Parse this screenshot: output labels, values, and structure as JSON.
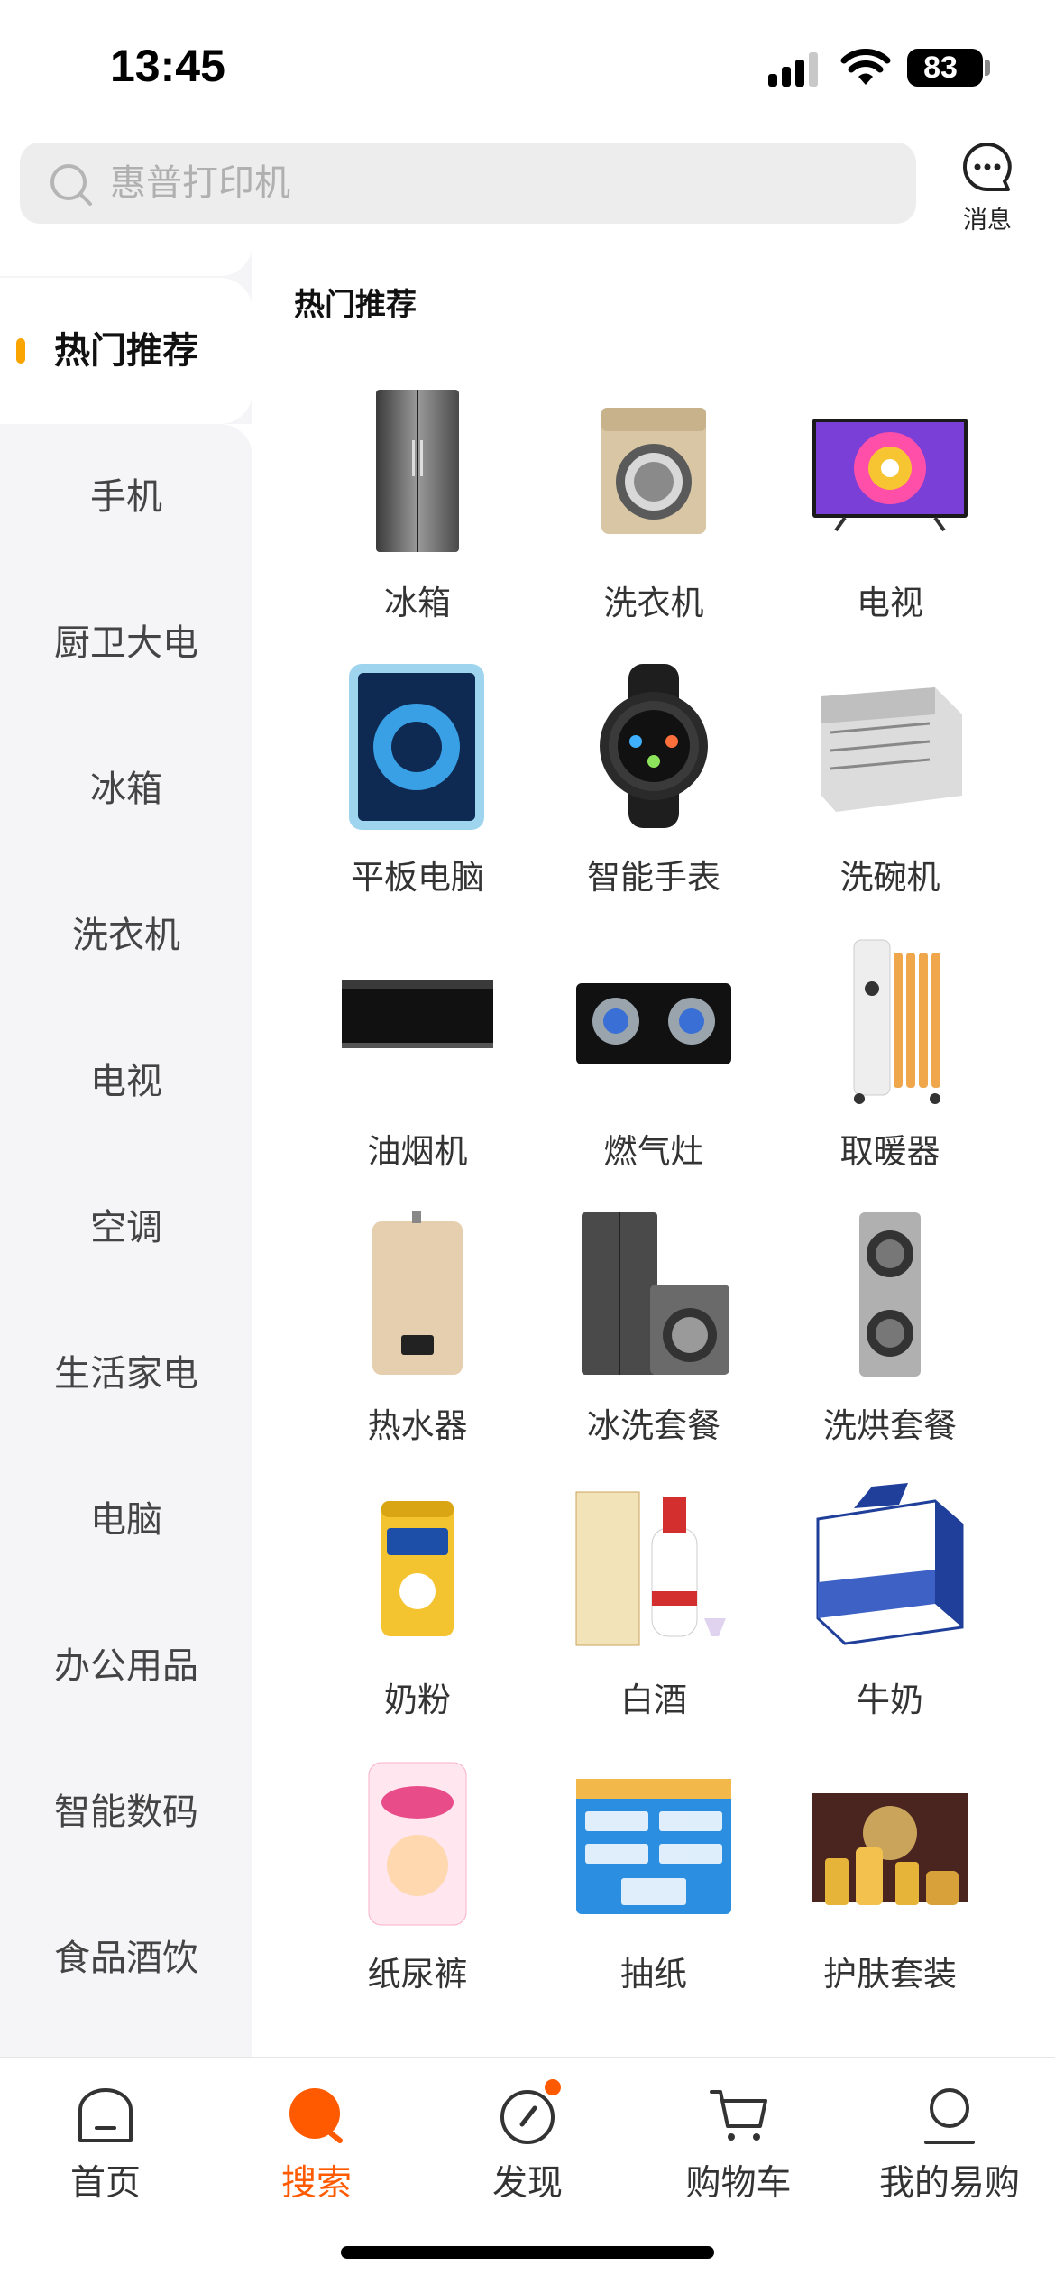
{
  "status_bar": {
    "time": "13:45",
    "battery": "83",
    "icons": [
      "signal-icon",
      "wifi-icon",
      "battery-icon"
    ]
  },
  "header": {
    "search_placeholder": "惠普打印机",
    "message_label": "消息"
  },
  "colors": {
    "accent": "#ff5a00",
    "active_marker": "#f9a400",
    "sidebar_bg": "#f5f5f7"
  },
  "sidebar": {
    "items": [
      {
        "label": "热门推荐",
        "active": true
      },
      {
        "label": "手机"
      },
      {
        "label": "厨卫大电"
      },
      {
        "label": "冰箱"
      },
      {
        "label": "洗衣机"
      },
      {
        "label": "电视"
      },
      {
        "label": "空调"
      },
      {
        "label": "生活家电"
      },
      {
        "label": "电脑"
      },
      {
        "label": "办公用品"
      },
      {
        "label": "智能数码"
      },
      {
        "label": "食品酒饮"
      }
    ]
  },
  "content": {
    "section_title": "热门推荐",
    "items": [
      {
        "label": "冰箱",
        "icon": "refrigerator-icon"
      },
      {
        "label": "洗衣机",
        "icon": "washing-machine-icon"
      },
      {
        "label": "电视",
        "icon": "tv-icon"
      },
      {
        "label": "平板电脑",
        "icon": "tablet-icon"
      },
      {
        "label": "智能手表",
        "icon": "smartwatch-icon"
      },
      {
        "label": "洗碗机",
        "icon": "dishwasher-icon"
      },
      {
        "label": "油烟机",
        "icon": "range-hood-icon"
      },
      {
        "label": "燃气灶",
        "icon": "gas-stove-icon"
      },
      {
        "label": "取暖器",
        "icon": "heater-icon"
      },
      {
        "label": "热水器",
        "icon": "water-heater-icon"
      },
      {
        "label": "冰洗套餐",
        "icon": "fridge-washer-bundle-icon"
      },
      {
        "label": "洗烘套餐",
        "icon": "washer-dryer-stack-icon"
      },
      {
        "label": "奶粉",
        "icon": "milk-powder-can-icon"
      },
      {
        "label": "白酒",
        "icon": "baijiu-bottle-icon"
      },
      {
        "label": "牛奶",
        "icon": "milk-box-icon"
      },
      {
        "label": "纸尿裤",
        "icon": "diaper-pack-icon"
      },
      {
        "label": "抽纸",
        "icon": "tissue-pack-icon"
      },
      {
        "label": "护肤套装",
        "icon": "skincare-set-icon"
      }
    ]
  },
  "tabbar": {
    "tabs": [
      {
        "label": "首页",
        "icon": "home-icon"
      },
      {
        "label": "搜索",
        "icon": "search-icon",
        "active": true
      },
      {
        "label": "发现",
        "icon": "compass-icon",
        "badge_dot": true
      },
      {
        "label": "购物车",
        "icon": "cart-icon"
      },
      {
        "label": "我的易购",
        "icon": "user-icon"
      }
    ]
  }
}
